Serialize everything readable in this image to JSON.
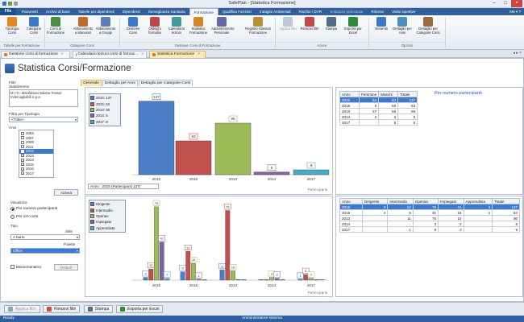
{
  "window": {
    "title": "SafePlan - [Statistica Formazione]"
  },
  "menu": {
    "file": "File",
    "tabs": [
      "Parametri",
      "Archivi di base",
      "Tabelle per dipendenti",
      "Dipendenti",
      "Sorveglianza Sanitaria",
      "Formazione",
      "Qualifica Fornitori",
      "Indagini Ambientali",
      "Rischio / DVR",
      "Sostanze pericolose",
      "Risorse",
      "Visite ispettive"
    ],
    "active": 5,
    "dim": [
      9
    ],
    "user": "SM",
    "user_extra": "?"
  },
  "ribbon": {
    "buttons": [
      "Tipologia Corsi",
      "Categorie Corsi",
      "Corsi di Formazione",
      "Abbinamento a Mansioni",
      "Abbinamento a Gruppi",
      "Gestione Corsi",
      "Obblighi formativi",
      "Calendario lezioni",
      "Statistica Formazione",
      "Addestramento Personale",
      "Registro Attestati Formazione",
      "Applica filtri",
      "Rimuovi filtri",
      "Stampa",
      "Esporta per Excel",
      "Generali",
      "Dettaglio per Anni",
      "Dettaglio per Categorie Corsi"
    ],
    "groups": [
      "Tabelle per Formazione",
      "Categorie Corsi",
      "Gestione Corsi di Formazione",
      "Azioni",
      "Opzioni"
    ]
  },
  "doc_tabs": [
    "Gestione corsi di formazione",
    "Calendario lezioni corsi di formaz...",
    "Statistica Formazione"
  ],
  "page": {
    "title": "Statistica Corsi/Formazione"
  },
  "filters": {
    "filtri": "Filtri",
    "stabilimento": "Stabilimento",
    "company": "M.I.T.I. Manifattura Italiana Tessuti Indemagliabili S.p.a.",
    "tipologia_label": "Filtra per Tipologia",
    "tipologia_value": "<Tutte>",
    "anni_label": "Anni",
    "years": [
      {
        "y": "2004",
        "on": false
      },
      {
        "y": "2007",
        "on": false
      },
      {
        "y": "2008",
        "on": false
      },
      {
        "y": "2011",
        "on": false
      },
      {
        "y": "2012",
        "on": true
      },
      {
        "y": "2013",
        "on": true
      },
      {
        "y": "2014",
        "on": true
      },
      {
        "y": "2015",
        "on": true
      },
      {
        "y": "2016",
        "on": true
      },
      {
        "y": "2017",
        "on": true
      }
    ],
    "azzera": "Azzera",
    "visualizza": "Visualizza",
    "per_num": "Per numero partecipanti",
    "per_ore": "Per ore corsi",
    "tipo": "Tipo",
    "stile": "Stile",
    "stile_value": "A barre",
    "palette": "Palette",
    "palette_value": "Office",
    "mono": "Monocromatico",
    "default": "Default"
  },
  "inner_tabs": [
    "Generale",
    "Dettaglio per Anni",
    "Dettaglio per Categorie Corsi"
  ],
  "per_numero_title": "Per numero partecipanti",
  "bar_info": "Anno : 2016 (Partecipanti 137)",
  "chart_data": [
    {
      "type": "bar",
      "categories": [
        "2016",
        "2015",
        "2013",
        "2014",
        "2017"
      ],
      "values": [
        137,
        63,
        96,
        5,
        9
      ],
      "legend": [
        "2016: 137",
        "2015: 63",
        "2013: 96",
        "2014: 5",
        "2017: 9"
      ],
      "colors": [
        "#4a7fc6",
        "#c0504d",
        "#9bbb59",
        "#7f64a0",
        "#4bacc6"
      ],
      "axis_label": "Partecipanti",
      "ylim": [
        0,
        150
      ]
    },
    {
      "type": "bar",
      "categories": [
        "2016",
        "2015",
        "2013",
        "2014",
        "2017"
      ],
      "series": [
        {
          "name": "Dirigente",
          "values": [
            3,
            9,
            11,
            0,
            1
          ],
          "color": "#4a7fc6"
        },
        {
          "name": "Intermedio",
          "values": [
            12,
            31,
            75,
            0,
            6
          ],
          "color": "#c0504d"
        },
        {
          "name": "Operaio",
          "values": [
            79,
            18,
            10,
            3,
            2
          ],
          "color": "#9bbb59"
        },
        {
          "name": "Impiegato",
          "values": [
            41,
            1,
            0,
            2,
            0
          ],
          "color": "#7f64a0"
        },
        {
          "name": "Apprendista",
          "values": [
            2,
            0,
            0,
            0,
            0
          ],
          "color": "#4bacc6"
        }
      ],
      "axis_label": "Partecipanti",
      "ylim": [
        0,
        85
      ]
    }
  ],
  "table1": {
    "headers": [
      "Anno",
      "Femmine",
      "Maschi",
      "Totale"
    ],
    "rows": [
      [
        "2016",
        "55",
        "82",
        "137"
      ],
      [
        "2015",
        "5",
        "58",
        "63"
      ],
      [
        "2013",
        "37",
        "59",
        "96"
      ],
      [
        "2014",
        "2",
        "3",
        "5"
      ],
      [
        "2017",
        "",
        "9",
        "9"
      ]
    ]
  },
  "table2": {
    "headers": [
      "Anno",
      "Dirigente",
      "Intermedio",
      "Operaio",
      "Impiegato",
      "Apprendista",
      "Totale"
    ],
    "rows": [
      [
        "2016",
        "3",
        "12",
        "79",
        "41",
        "2",
        "137"
      ],
      [
        "2015",
        "4",
        "9",
        "31",
        "18",
        "1",
        "63"
      ],
      [
        "2013",
        "",
        "11",
        "75",
        "10",
        "",
        "96"
      ],
      [
        "2014",
        "",
        "",
        "3",
        "2",
        "",
        "5"
      ],
      [
        "2017",
        "",
        "1",
        "6",
        "2",
        "",
        "9"
      ]
    ]
  },
  "bottom": {
    "apply": "Applica filtri",
    "remove": "Rimuovi filtri",
    "print": "Stampa",
    "excel": "Esporta per Excel"
  },
  "status": {
    "left": "Ready",
    "center": "Amministratore sistema"
  }
}
